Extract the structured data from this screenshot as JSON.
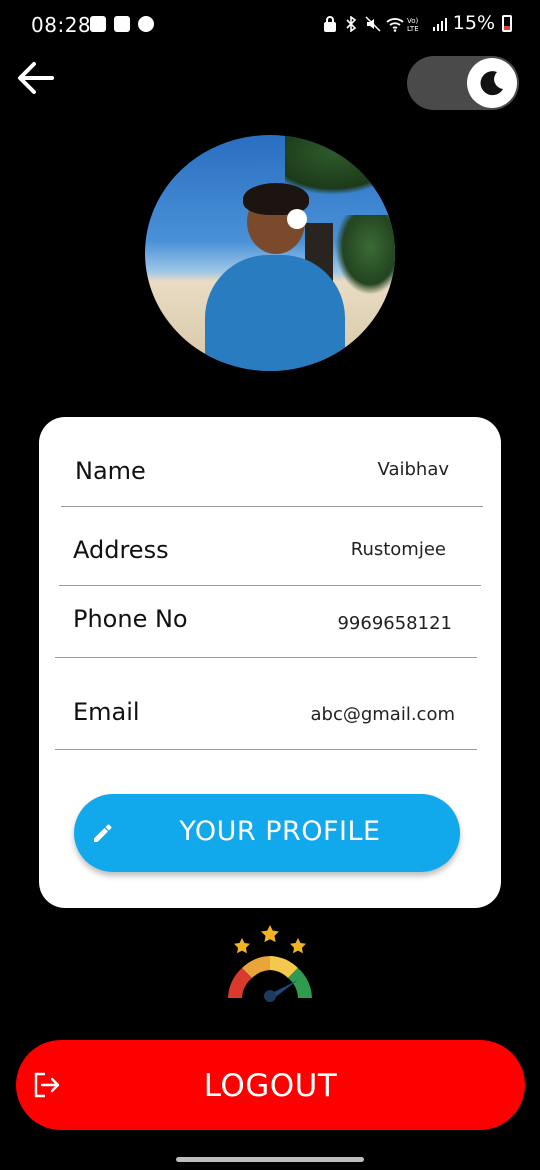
{
  "status_bar": {
    "time": "08:28",
    "battery": "15%",
    "network": "Vo) LTE"
  },
  "header": {
    "back_icon": "arrow-left-icon",
    "theme_toggle_icon": "moon-icon",
    "theme_toggle_state": "dark"
  },
  "profile": {
    "fields": [
      {
        "label": "Name",
        "value": "Vaibhav"
      },
      {
        "label": "Address",
        "value": "Rustomjee"
      },
      {
        "label": "Phone No",
        "value": "9969658121"
      },
      {
        "label": "Email",
        "value": "abc@gmail.com"
      }
    ],
    "button_label": "YOUR PROFILE",
    "button_icon": "pencil-icon"
  },
  "rating_icon": "rating-meter-icon",
  "logout": {
    "label": "LOGOUT",
    "icon": "logout-icon"
  },
  "colors": {
    "background": "#000000",
    "card": "#ffffff",
    "profile_button": "#12a8ec",
    "logout_button": "#ff0000",
    "toggle_track": "#4a4a4a"
  }
}
